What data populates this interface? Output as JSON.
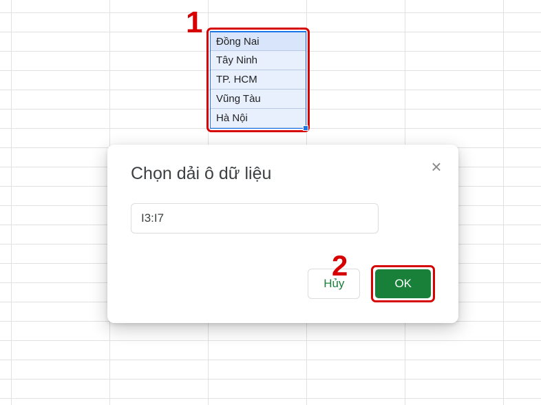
{
  "selection": {
    "items": [
      "Đồng Nai",
      "Tây Ninh",
      "TP. HCM",
      "Vũng Tàu",
      "Hà Nội"
    ]
  },
  "annotations": {
    "step1": "1",
    "step2": "2"
  },
  "dialog": {
    "title": "Chọn dải ô dữ liệu",
    "range_value": "I3:I7",
    "cancel_label": "Hủy",
    "ok_label": "OK"
  }
}
